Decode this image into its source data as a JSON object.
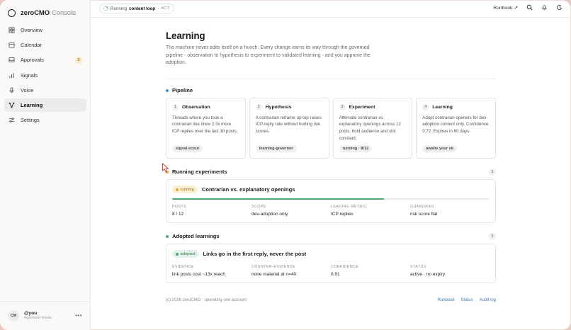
{
  "brand": {
    "name": "zeroCMO",
    "suffix": "Console"
  },
  "nav": [
    {
      "label": "Overview",
      "icon": "grid-icon"
    },
    {
      "label": "Calendar",
      "icon": "calendar-icon"
    },
    {
      "label": "Approvals",
      "icon": "inbox-icon",
      "badge": "2"
    },
    {
      "label": "Signals",
      "icon": "bar-chart-icon"
    },
    {
      "label": "Voice",
      "icon": "microphone-icon"
    },
    {
      "label": "Learning",
      "icon": "branch-icon",
      "active": true
    },
    {
      "label": "Settings",
      "icon": "sliders-icon"
    }
  ],
  "user": {
    "initials": "CM",
    "name": "@you",
    "mode": "Approval mode",
    "more": "•••"
  },
  "topbar": {
    "status_prefix": "Running",
    "status_name": "content loop",
    "status_sep": "·",
    "status_mode": "ACT",
    "runbook": "Runbook ↗"
  },
  "page": {
    "title": "Learning",
    "description": "The machine never edits itself on a hunch. Every change earns its way through the governed pipeline - observation to hypothesis to experiment to validated learning - and you approve the adoption."
  },
  "pipeline": {
    "title": "Pipeline",
    "stages": [
      {
        "num": "1",
        "title": "Observation",
        "text": "Threads where you took a contrarian line drew 2.3x more ICP replies over the last 30 posts.",
        "chip": "signal-scout"
      },
      {
        "num": "2",
        "title": "Hypothesis",
        "text": "A contrarian reframe up top raises ICP-reply rate without hurting risk scores.",
        "chip": "learning-governor"
      },
      {
        "num": "3",
        "title": "Experiment",
        "text": "Alternate contrarian vs. explanatory openings across 12 posts; hold audience and slot constant.",
        "chip": "running · 8/12"
      },
      {
        "num": "4",
        "title": "Learning",
        "text": "Adopt contrarian openers for dev-adoption content only. Confidence 0.72. Expires in 60 days.",
        "chip": "awaits your ok"
      }
    ]
  },
  "running": {
    "title": "Running experiments",
    "count": "1",
    "status": "running",
    "name": "Contrarian vs. explanatory openings",
    "progress": 0.667,
    "stats": [
      {
        "label": "POSTS",
        "value": "8 / 12"
      },
      {
        "label": "SCOPE",
        "value": "dev-adoption only"
      },
      {
        "label": "LEADING METRIC",
        "value": "ICP replies"
      },
      {
        "label": "GUARDRAIL",
        "value": "risk score flat"
      }
    ]
  },
  "adopted": {
    "title": "Adopted learnings",
    "count": "1",
    "status": "adopted",
    "name": "Links go in the first reply, never the post",
    "stats": [
      {
        "label": "EVIDENCE",
        "value": "link posts cost ~13x reach"
      },
      {
        "label": "COUNTER-EVIDENCE",
        "value": "none material at n=40"
      },
      {
        "label": "CONFIDENCE",
        "value": "0.91"
      },
      {
        "label": "STATUS",
        "value": "active · no expiry"
      }
    ]
  },
  "footer": {
    "copyright": "(c) 2026 zeroCMO · operating one account",
    "links": [
      "Runbook",
      "Status",
      "Audit log"
    ]
  },
  "colors": {
    "pipeline_dot": "#3d8bd6",
    "running_dot": "#e0a93a",
    "adopted_dot": "#4fa877",
    "running_pill_bg": "#fbf0d4",
    "running_pill_fg": "#8a6412",
    "adopted_pill_bg": "#e3f2e9",
    "adopted_pill_fg": "#2f7a50"
  }
}
